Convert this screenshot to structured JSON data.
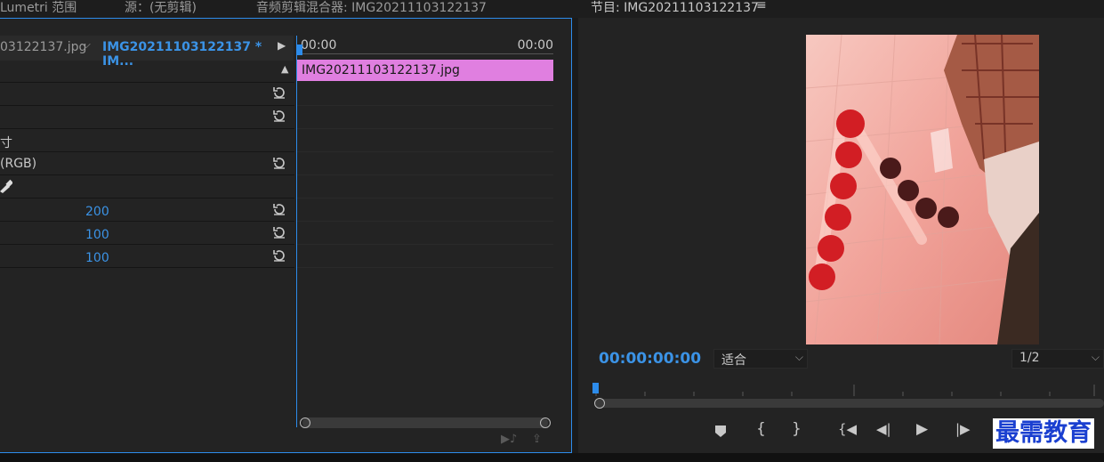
{
  "tabs": {
    "lumetri": "Lumetri 范围",
    "source": "源：(无剪辑)",
    "audio_mixer": "音频剪辑混合器: IMG20211103122137"
  },
  "effect_controls": {
    "source_clip": "03122137.jpg",
    "sequence_clip": "IMG20211103122137 * IM...",
    "time_start": "00:00",
    "time_end": "00:00",
    "clip_name": "IMG20211103122137.jpg",
    "rows": [
      {
        "label": ""
      },
      {
        "label": ""
      },
      {
        "label": "寸"
      },
      {
        "label": "(RGB)"
      },
      {
        "label": ""
      },
      {
        "label": "",
        "value": "200"
      },
      {
        "label": "",
        "value": "100"
      },
      {
        "label": "",
        "value": "100"
      }
    ]
  },
  "program": {
    "title": "节目: IMG20211103122137",
    "menu_icon": "≡",
    "timecode": "00:00:00:00",
    "fit_label": "适合",
    "resolution": "1/2"
  },
  "watermark": "最需教育",
  "colors": {
    "accent": "#2d8ceb",
    "clip": "#e07fe0",
    "timecode": "#3b93e6"
  }
}
